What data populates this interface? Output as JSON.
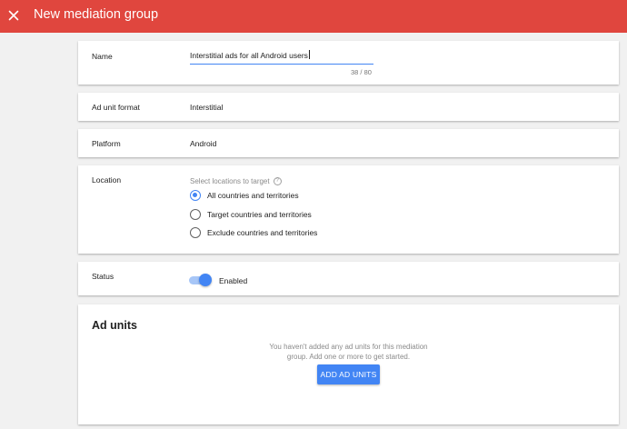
{
  "header": {
    "title": "New mediation group",
    "close_icon": "close-icon",
    "color": "#e0463e"
  },
  "name": {
    "label": "Name",
    "value": "Interstitial ads for all Android users",
    "counter": "38 / 80"
  },
  "ad_unit_format": {
    "label": "Ad unit format",
    "value": "Interstitial"
  },
  "platform": {
    "label": "Platform",
    "value": "Android"
  },
  "location": {
    "label": "Location",
    "hint": "Select locations to target",
    "help_icon": "help-icon",
    "options": [
      {
        "label": "All countries and territories",
        "selected": true
      },
      {
        "label": "Target countries and territories",
        "selected": false
      },
      {
        "label": "Exclude countries and territories",
        "selected": false
      }
    ]
  },
  "status": {
    "label": "Status",
    "toggle_on": true,
    "value": "Enabled"
  },
  "ad_units": {
    "title": "Ad units",
    "empty_message": "You haven't added any ad units for this mediation group. Add one or more to get started.",
    "button_label": "ADD AD UNITS"
  },
  "accent_color": "#4285f4"
}
